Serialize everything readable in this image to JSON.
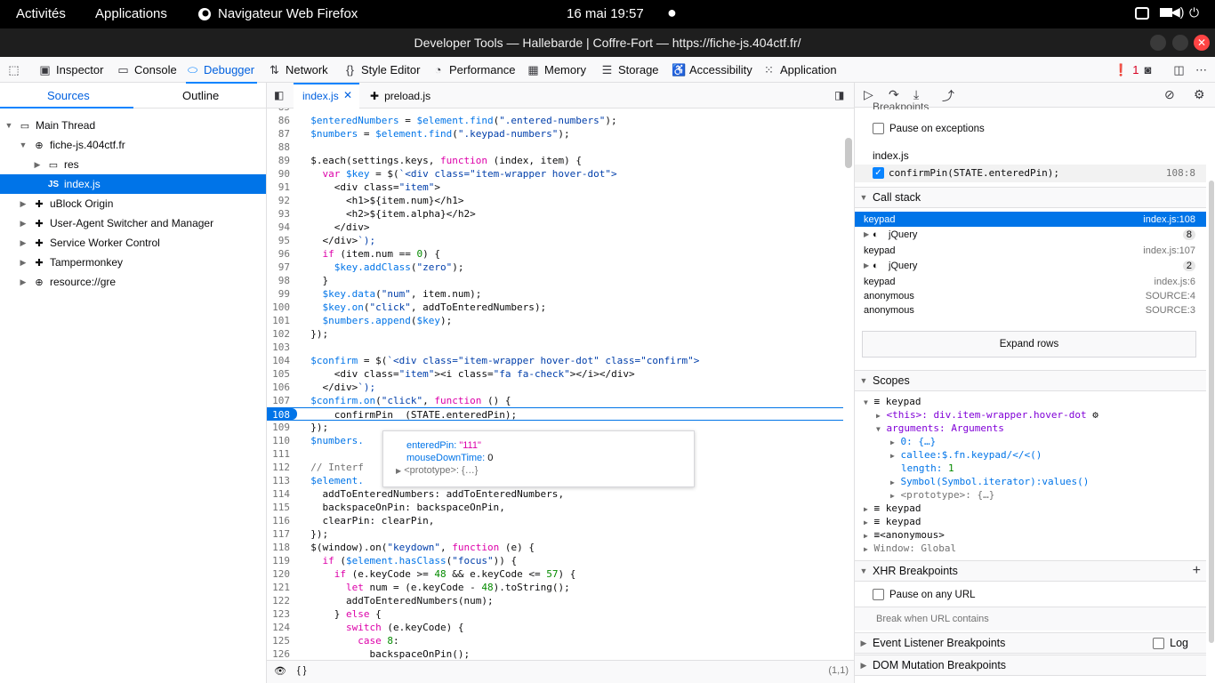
{
  "topbar": {
    "activities": "Activités",
    "applications": "Applications",
    "app_name": "Navigateur Web Firefox",
    "clock": "16 mai  19:57"
  },
  "window": {
    "title": "Developer Tools — Hallebarde | Coffre-Fort — https://fiche-js.404ctf.fr/"
  },
  "toolbar": {
    "tabs": [
      "Inspector",
      "Console",
      "Debugger",
      "Network",
      "Style Editor",
      "Performance",
      "Memory",
      "Storage",
      "Accessibility",
      "Application"
    ],
    "selected": "Debugger",
    "error_count": "1"
  },
  "left": {
    "tabs": [
      "Sources",
      "Outline"
    ],
    "tree": [
      {
        "label": "Main Thread",
        "icon": "window-icon"
      },
      {
        "label": "fiche-js.404ctf.fr",
        "icon": "globe-icon"
      },
      {
        "label": "res",
        "icon": "folder-icon"
      },
      {
        "label": "index.js",
        "icon": "js-file-icon",
        "prefix": "JS"
      },
      {
        "label": "uBlock Origin",
        "icon": "extension-icon"
      },
      {
        "label": "User-Agent Switcher and Manager",
        "icon": "extension-icon"
      },
      {
        "label": "Service Worker Control",
        "icon": "extension-icon"
      },
      {
        "label": "Tampermonkey",
        "icon": "extension-icon"
      },
      {
        "label": "resource://gre",
        "icon": "globe-icon"
      }
    ]
  },
  "editor": {
    "tabs": [
      {
        "label": "index.js"
      },
      {
        "label": "preload.js"
      }
    ],
    "lines": [
      {
        "n": "85",
        "t": ""
      },
      {
        "n": "86",
        "t": "  $enteredNumbers = $element.find(\".entered-numbers\");"
      },
      {
        "n": "87",
        "t": "  $numbers = $element.find(\".keypad-numbers\");"
      },
      {
        "n": "88",
        "t": ""
      },
      {
        "n": "89",
        "t": "  $.each(settings.keys, function (index, item) {"
      },
      {
        "n": "90",
        "t": "    var $key = $(`<div class=\"item-wrapper hover-dot\">"
      },
      {
        "n": "91",
        "t": "      <div class=\"item\">"
      },
      {
        "n": "92",
        "t": "        <h1>${item.num}</h1>"
      },
      {
        "n": "93",
        "t": "        <h2>${item.alpha}</h2>"
      },
      {
        "n": "94",
        "t": "      </div>"
      },
      {
        "n": "95",
        "t": "    </div>`);"
      },
      {
        "n": "96",
        "t": "    if (item.num == 0) {"
      },
      {
        "n": "97",
        "t": "      $key.addClass(\"zero\");"
      },
      {
        "n": "98",
        "t": "    }"
      },
      {
        "n": "99",
        "t": "    $key.data(\"num\", item.num);"
      },
      {
        "n": "100",
        "t": "    $key.on(\"click\", addToEnteredNumbers);"
      },
      {
        "n": "101",
        "t": "    $numbers.append($key);"
      },
      {
        "n": "102",
        "t": "  });"
      },
      {
        "n": "103",
        "t": ""
      },
      {
        "n": "104",
        "t": "  $confirm = $(`<div class=\"item-wrapper hover-dot\" class=\"confirm\">"
      },
      {
        "n": "105",
        "t": "      <div class=\"item\"><i class=\"fa fa-check\"></i></div>"
      },
      {
        "n": "106",
        "t": "    </div>`);"
      },
      {
        "n": "107",
        "t": "  $confirm.on(\"click\", function () {"
      },
      {
        "n": "108",
        "t": "      confirmPin  (STATE.enteredPin);"
      },
      {
        "n": "109",
        "t": "  });"
      },
      {
        "n": "110",
        "t": "  $numbers."
      },
      {
        "n": "111",
        "t": ""
      },
      {
        "n": "112",
        "t": "  // Interf"
      },
      {
        "n": "113",
        "t": "  $element."
      },
      {
        "n": "114",
        "t": "    addToEnteredNumbers: addToEnteredNumbers,"
      },
      {
        "n": "115",
        "t": "    backspaceOnPin: backspaceOnPin,"
      },
      {
        "n": "116",
        "t": "    clearPin: clearPin,"
      },
      {
        "n": "117",
        "t": "  });"
      },
      {
        "n": "118",
        "t": "  $(window).on(\"keydown\", function (e) {"
      },
      {
        "n": "119",
        "t": "    if ($element.hasClass(\"focus\")) {"
      },
      {
        "n": "120",
        "t": "      if (e.keyCode >= 48 && e.keyCode <= 57) {"
      },
      {
        "n": "121",
        "t": "        let num = (e.keyCode - 48).toString();"
      },
      {
        "n": "122",
        "t": "        addToEnteredNumbers(num);"
      },
      {
        "n": "123",
        "t": "      } else {"
      },
      {
        "n": "124",
        "t": "        switch (e.keyCode) {"
      },
      {
        "n": "125",
        "t": "          case 8:"
      },
      {
        "n": "126",
        "t": "            backspaceOnPin();"
      }
    ],
    "breakpoint_line": "108",
    "tooltip": {
      "row1_key": "enteredPin:",
      "row1_val": "\"111\"",
      "row2_key": "mouseDownTime:",
      "row2_val": "0",
      "row3": "<prototype>: {…}"
    },
    "footer": {
      "braces": "{ }",
      "position": "(1,1)"
    }
  },
  "right": {
    "breakpoints_header": "Breakpoints",
    "pause_exceptions": "Pause on exceptions",
    "bp_file": "index.js",
    "bp_code": "confirmPin(STATE.enteredPin);",
    "bp_loc": "108:8",
    "callstack_header": "Call stack",
    "callstack": [
      {
        "fn": "keypad",
        "loc": "index.js:108",
        "sel": true
      },
      {
        "fn": "jQuery",
        "badge": "8",
        "group": true
      },
      {
        "fn": "keypad",
        "loc": "index.js:107"
      },
      {
        "fn": "jQuery",
        "badge": "2",
        "group": true
      },
      {
        "fn": "keypad",
        "loc": "index.js:6"
      },
      {
        "fn": "anonymous",
        "loc": "SOURCE:4"
      },
      {
        "fn": "anonymous",
        "loc": "SOURCE:3"
      }
    ],
    "expand_rows": "Expand rows",
    "scopes_header": "Scopes",
    "scopes": {
      "keypad": "keypad",
      "this_key": "<this>:",
      "this_val": "div.item-wrapper.hover-dot",
      "args_key": "arguments:",
      "args_val": "Arguments",
      "a0": "0: {…}",
      "callee": "callee:$.fn.keypad/</<()",
      "length_key": "length:",
      "length_val": "1",
      "symbol": "Symbol(Symbol.iterator):values()",
      "proto": "<prototype>: {…}",
      "k2": "keypad",
      "k3": "keypad",
      "anon": "<anonymous>",
      "window": "Window: Global"
    },
    "xhr_header": "XHR Breakpoints",
    "pause_url": "Pause on any URL",
    "break_url": "Break when URL contains",
    "event_header": "Event Listener Breakpoints",
    "log": "Log",
    "dom_header": "DOM Mutation Breakpoints"
  }
}
